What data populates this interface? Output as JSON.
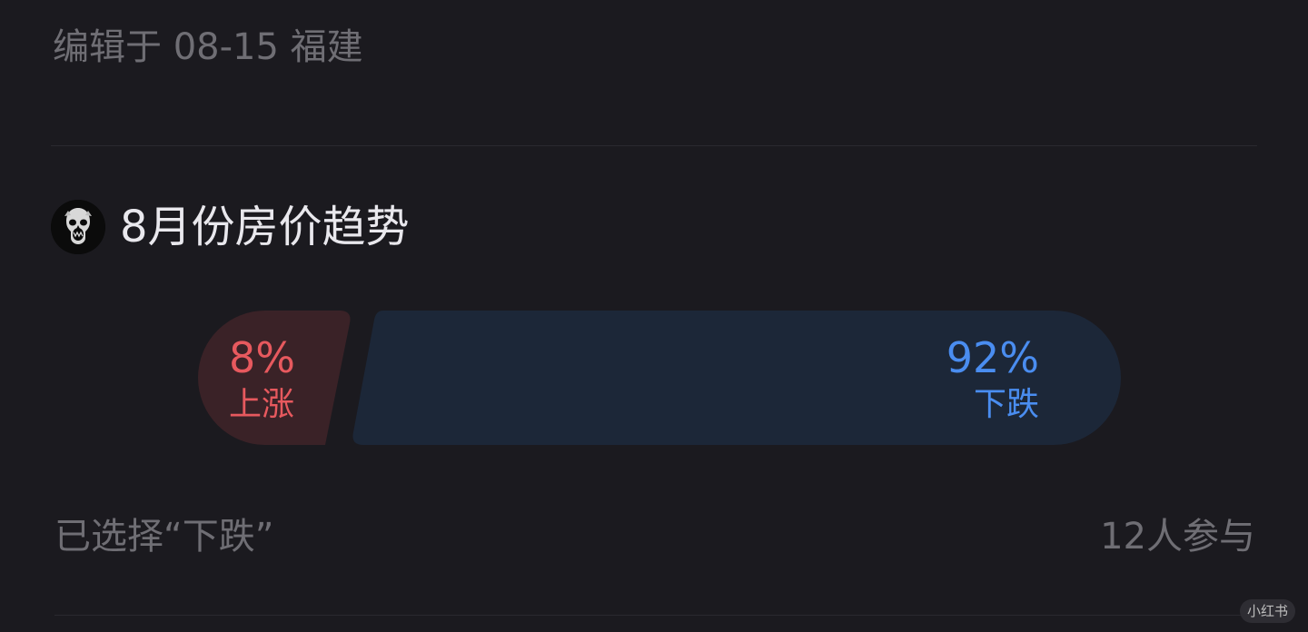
{
  "post": {
    "edited_meta": "编辑于 08-15 福建"
  },
  "poll": {
    "title": "8月份房价趋势",
    "options": [
      {
        "label": "上涨",
        "percent_text": "8%",
        "percent": 8,
        "color": "#e7595e"
      },
      {
        "label": "下跌",
        "percent_text": "92%",
        "percent": 92,
        "color": "#4a8df0"
      }
    ],
    "selected_text": "已选择“下跌”",
    "participants_text": "12人参与"
  },
  "watermark": {
    "text": "小红书"
  },
  "colors": {
    "background": "#1b1a1f",
    "up_fill": "#3a2227",
    "down_fill": "#1c2738",
    "muted_text": "#6f6e74"
  },
  "icons": {
    "avatar": "skull-avatar-icon"
  }
}
